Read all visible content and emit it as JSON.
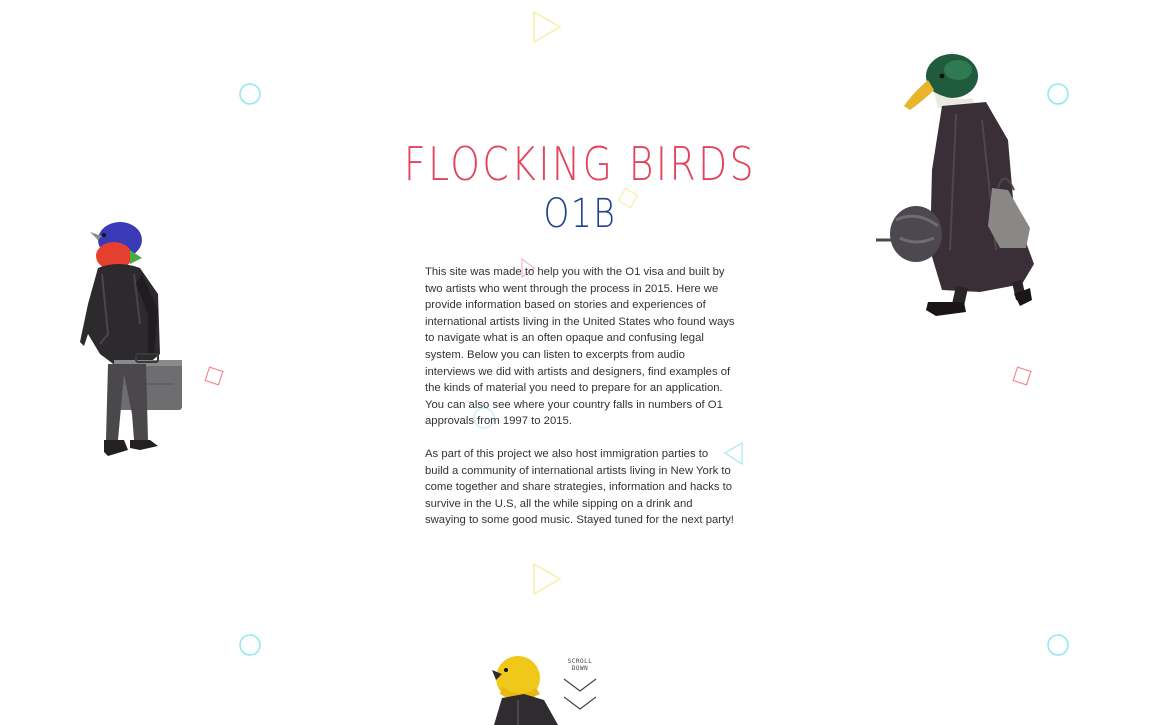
{
  "header": {
    "title": "FLOCKING BIRDS",
    "subtitle": "O1B"
  },
  "intro": {
    "paragraph_1": "This site was made to help you with the O1 visa and built by two artists who went through the process in 2015. Here we provide information based on stories and experiences of international artists living in the United States who found ways to navigate what is an often opaque and confusing legal system. Below you can listen to excerpts from audio interviews we did with artists and designers, find examples of the kinds of material you need to prepare for an application. You can also see where your country falls in numbers of O1 approvals from 1997 to 2015.",
    "paragraph_2": "As part of this project we also host immigration parties to build a community of international artists living in New York to come together and share strategies, information and hacks to survive in the U.S, all the while sipping on a drink and swaying to some good music. Stayed tuned for the next party!"
  },
  "scroll": {
    "line_1": "SCROLL",
    "line_2": "DOWN"
  },
  "colors": {
    "title": "#e2445b",
    "subtitle": "#1f3f8f",
    "text": "#333333",
    "circle": "#7fe6f0",
    "square": "#f07a86",
    "triangle_yellow": "#f2ef9a",
    "triangle_cyan": "#9fe6f0"
  },
  "decorations": {
    "birds": [
      "painted-bunting-figure",
      "mallard-duck-figure",
      "yellow-bird-figure"
    ],
    "shapes": [
      "circle-icon",
      "square-icon",
      "triangle-icon"
    ]
  }
}
